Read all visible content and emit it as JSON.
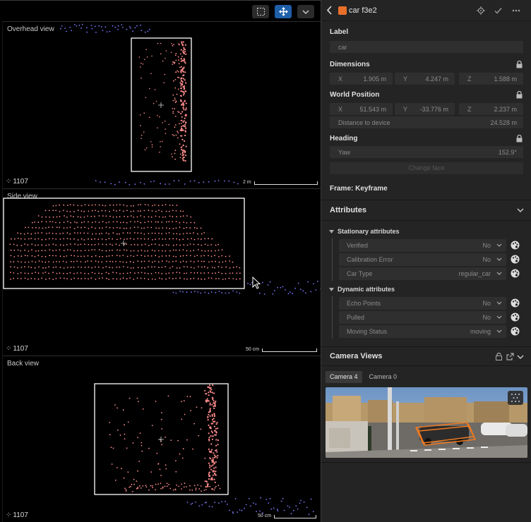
{
  "toolbar": {
    "buttons": [
      {
        "name": "select-box-tool",
        "icon": "select-box-icon",
        "active": false
      },
      {
        "name": "move-tool",
        "icon": "move-arrows-icon",
        "active": true
      },
      {
        "name": "more-tools-dropdown",
        "icon": "chevron-down-icon",
        "active": false
      }
    ]
  },
  "views": [
    {
      "title": "Overhead view",
      "frame": "1107",
      "scale": "2 m"
    },
    {
      "title": "Side view",
      "frame": "1107",
      "scale": "50 cm"
    },
    {
      "title": "Back view",
      "frame": "1107",
      "scale": "50 cm"
    }
  ],
  "panel": {
    "object_title": "car f3e2",
    "object_color": "#e8702a",
    "label_section": "Label",
    "label_placeholder": "car",
    "dimensions_section": "Dimensions",
    "dimensions": {
      "x_key": "X",
      "x": "1.905 m",
      "y_key": "Y",
      "y": "4.247 m",
      "z_key": "Z",
      "z": "1.588 m"
    },
    "world_position_section": "World Position",
    "world_position": {
      "x_key": "X",
      "x": "51.543 m",
      "y_key": "Y",
      "y": "-33.776 m",
      "z_key": "Z",
      "z": "2.237 m"
    },
    "distance_label": "Distance to device",
    "distance_value": "24.528 m",
    "heading_section": "Heading",
    "yaw_label": "Yaw",
    "yaw_value": "152.9°",
    "change_face": "Change face",
    "frame_label": "Frame: Keyframe",
    "attributes_header": "Attributes",
    "stationary_header": "Stationary attributes",
    "stationary": [
      {
        "name": "Verified",
        "value": "No"
      },
      {
        "name": "Calibration Error",
        "value": "No"
      },
      {
        "name": "Car Type",
        "value": "regular_car"
      }
    ],
    "dynamic_header": "Dynamic attributes",
    "dynamic": [
      {
        "name": "Echo Points",
        "value": "No"
      },
      {
        "name": "Pulled",
        "value": "No"
      },
      {
        "name": "Moving Status",
        "value": "moving"
      }
    ],
    "camera_header": "Camera Views",
    "camera_tabs": [
      "Camera 4",
      "Camera 0"
    ],
    "selected_camera": "Camera 4"
  },
  "colors": {
    "accent": "#1f5fa8",
    "points_object": "#ff8c8c",
    "points_ground": "#7a7aff",
    "box_outline": "#ffffff",
    "camera_box": "#f07a20"
  }
}
